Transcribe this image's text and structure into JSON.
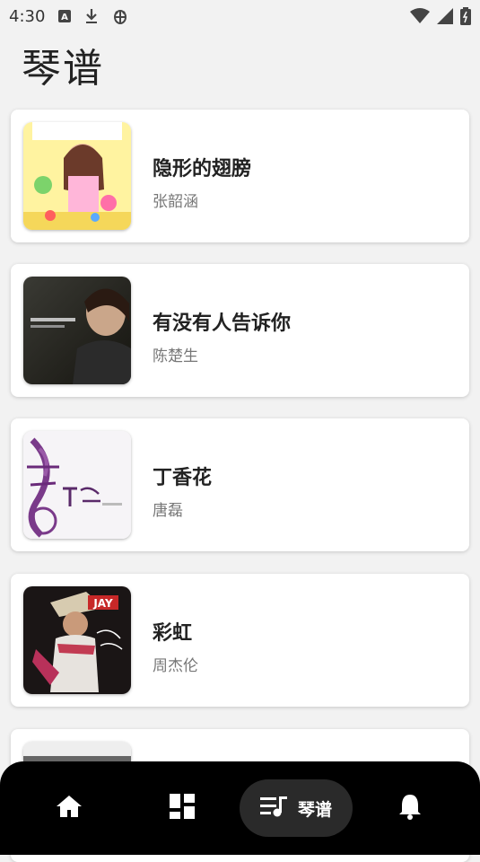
{
  "status": {
    "time": "4:30",
    "icons": [
      "font-icon",
      "download-icon",
      "bug-icon",
      "wifi-icon",
      "signal-icon",
      "battery-icon"
    ]
  },
  "page": {
    "title": "琴谱"
  },
  "songs": [
    {
      "title": "隐形的翅膀",
      "artist": "张韶涵"
    },
    {
      "title": "有没有人告诉你",
      "artist": "陈楚生"
    },
    {
      "title": "丁香花",
      "artist": "唐磊"
    },
    {
      "title": "彩虹",
      "artist": "周杰伦"
    }
  ],
  "nav": {
    "items": [
      "home-icon",
      "dashboard-icon",
      "music-queue-icon",
      "bell-icon"
    ],
    "active_label": "琴谱"
  },
  "colors": {
    "background": "#f2f2f2",
    "nav_background": "#000000",
    "nav_active": "#2a2a2a"
  }
}
